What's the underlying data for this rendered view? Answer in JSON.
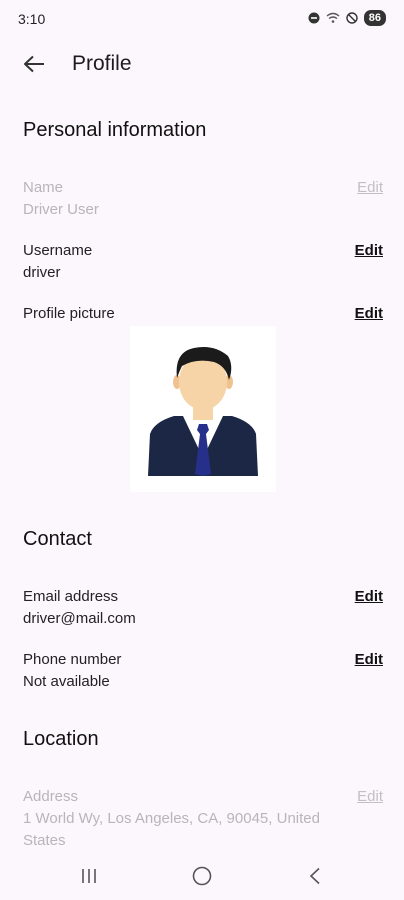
{
  "status_bar": {
    "time": "3:10",
    "battery": "86"
  },
  "header": {
    "title": "Profile"
  },
  "sections": {
    "personal": {
      "title": "Personal information",
      "name": {
        "label": "Name",
        "value": "Driver User",
        "edit": "Edit"
      },
      "username": {
        "label": "Username",
        "value": "driver",
        "edit": "Edit"
      },
      "picture": {
        "label": "Profile picture",
        "edit": "Edit"
      }
    },
    "contact": {
      "title": "Contact",
      "email": {
        "label": "Email address",
        "value": "driver@mail.com",
        "edit": "Edit"
      },
      "phone": {
        "label": "Phone number",
        "value": "Not available",
        "edit": "Edit"
      }
    },
    "location": {
      "title": "Location",
      "address": {
        "label": "Address",
        "value": "1 World Wy, Los Angeles, CA, 90045, United States",
        "edit": "Edit"
      }
    }
  },
  "colors": {
    "background": "#fcf7fd",
    "disabled_text": "#b9b4bc",
    "avatar_suit": "#1c2745",
    "avatar_tie": "#26308a"
  },
  "icons": [
    "back-arrow-icon",
    "dnd-icon",
    "wifi-icon",
    "block-icon",
    "recent-apps-icon",
    "home-icon",
    "nav-back-icon"
  ]
}
